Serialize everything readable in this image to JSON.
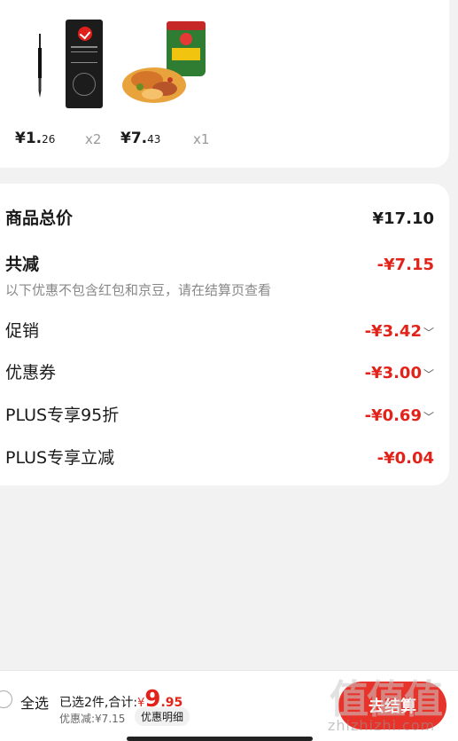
{
  "products": [
    {
      "price_main": "¥1.",
      "price_dec": "26",
      "qty": "x2"
    },
    {
      "price_main": "¥7.",
      "price_dec": "43",
      "qty": "x1"
    }
  ],
  "summary": {
    "total_label": "商品总价",
    "total_value": "¥17.10",
    "reduce_label": "共减",
    "reduce_value": "-¥7.15",
    "note": "以下优惠不包含红包和京豆，请在结算页查看",
    "items": [
      {
        "label": "促销",
        "value": "-¥3.42"
      },
      {
        "label": "优惠券",
        "value": "-¥3.00"
      },
      {
        "label": "PLUS专享95折",
        "value": "-¥0.69"
      },
      {
        "label": "PLUS专享立减",
        "value": "-¥0.04"
      }
    ]
  },
  "bottom": {
    "select_all": "全选",
    "selected_text": "已选2件,合计:",
    "currency": "¥",
    "total_int": "9",
    "total_dec": ".95",
    "discount_text": "优惠减:¥7.15",
    "detail_button": "优惠明细",
    "checkout_button": "去结算",
    "watermark": "zhizhizhi.com",
    "watermark_logo": "值值值"
  },
  "colors": {
    "accent": "#e2231a",
    "button": "#e8332b"
  },
  "icons": {
    "chevron": "chevron-down-icon",
    "radio": "radio-unchecked-icon"
  }
}
